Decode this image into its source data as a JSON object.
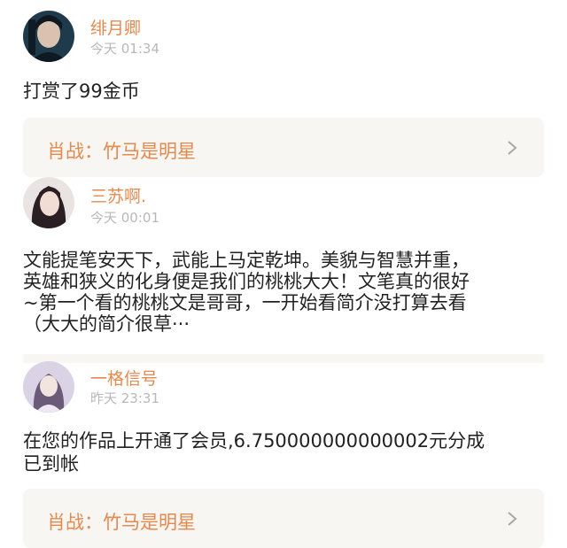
{
  "feed": [
    {
      "username": "绯月卿",
      "time": "今天 01:34",
      "content": [
        "打赏了99金币"
      ],
      "work_title": "肖战：竹马是明星"
    },
    {
      "username": "三苏啊.",
      "time": "今天 00:01",
      "content": [
        "文能提笔安天下，武能上马定乾坤。美貌与智慧并重，",
        "英雄和狭义的化身便是我们的桃桃大大！文笔真的很好",
        "~第一个看的桃桃文是哥哥，一开始看简介没打算去看",
        "（大大的简介很草···"
      ]
    },
    {
      "username": "一格信号",
      "time": "昨天 23:31",
      "content": [
        "在您的作品上开通了会员,6.750000000000002元分成",
        "已到帐"
      ],
      "work_title": "肖战：竹马是明星"
    }
  ],
  "colors": {
    "accent": "#e5894f",
    "card_bg": "#f7f6f2",
    "time": "#b8b8b8",
    "text": "#222222"
  }
}
